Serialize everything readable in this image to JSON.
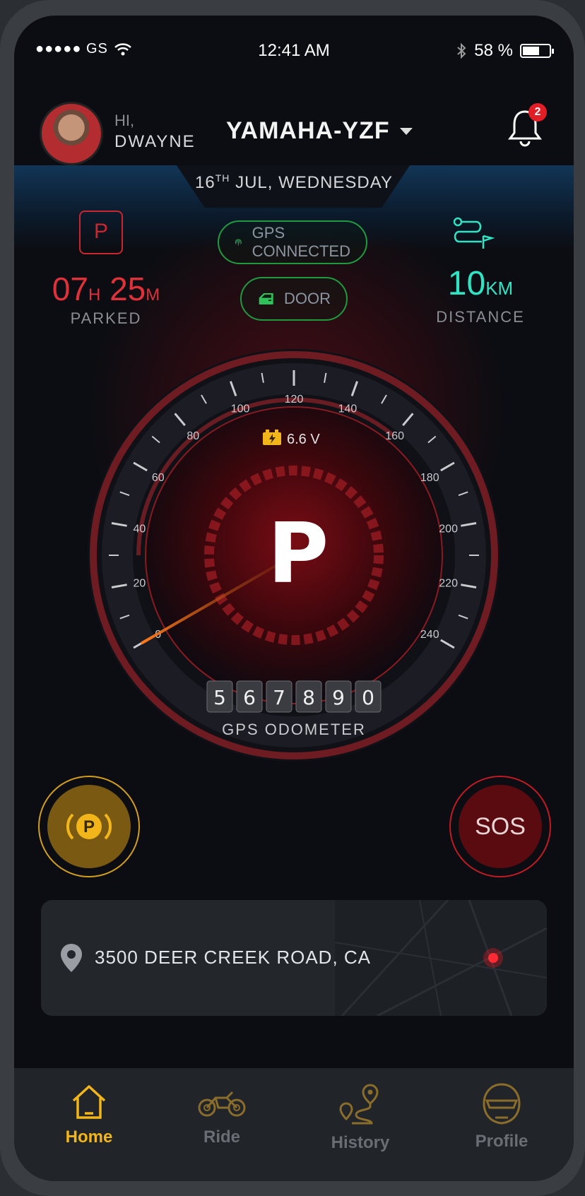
{
  "status_bar": {
    "signal": "●●●●● GS",
    "time": "12:41 AM",
    "battery_percent": "58 %",
    "battery_level": 0.58
  },
  "header": {
    "greeting": "HI,",
    "user_name": "DWAYNE",
    "vehicle_name": "YAMAHA-YZF",
    "notification_count": "2"
  },
  "date": {
    "day": "16",
    "suffix": "TH",
    "rest": "JUL, WEDNESDAY"
  },
  "parked": {
    "icon_letter": "P",
    "hours": "07",
    "hours_unit": "H",
    "minutes": "25",
    "minutes_unit": "M",
    "label": "PARKED"
  },
  "status_pills": {
    "gps": "GPS CONNECTED",
    "door": "DOOR"
  },
  "distance": {
    "value": "10",
    "unit": "KM",
    "label": "DISTANCE"
  },
  "gauge": {
    "ticks": [
      "0",
      "20",
      "40",
      "60",
      "80",
      "100",
      "120",
      "140",
      "160",
      "180",
      "200",
      "220",
      "240"
    ],
    "battery_voltage": "6.6 V",
    "gear": "P",
    "odometer_digits": [
      "5",
      "6",
      "7",
      "8",
      "9",
      "0"
    ],
    "odometer_label": "GPS ODOMETER",
    "speed": 0
  },
  "actions": {
    "park_letter": "P",
    "sos_label": "SOS"
  },
  "location": {
    "address": "3500 DEER CREEK ROAD,  CA"
  },
  "tabs": [
    {
      "label": "Home",
      "icon": "home-icon",
      "active": true
    },
    {
      "label": "Ride",
      "icon": "motorcycle-icon",
      "active": false
    },
    {
      "label": "History",
      "icon": "route-icon",
      "active": false
    },
    {
      "label": "Profile",
      "icon": "helmet-icon",
      "active": false
    }
  ],
  "colors": {
    "accent_red": "#e0313a",
    "accent_teal": "#2fe3c5",
    "accent_green": "#1f9a3f",
    "accent_yellow": "#f2b51a",
    "background": "#0c0d12"
  }
}
